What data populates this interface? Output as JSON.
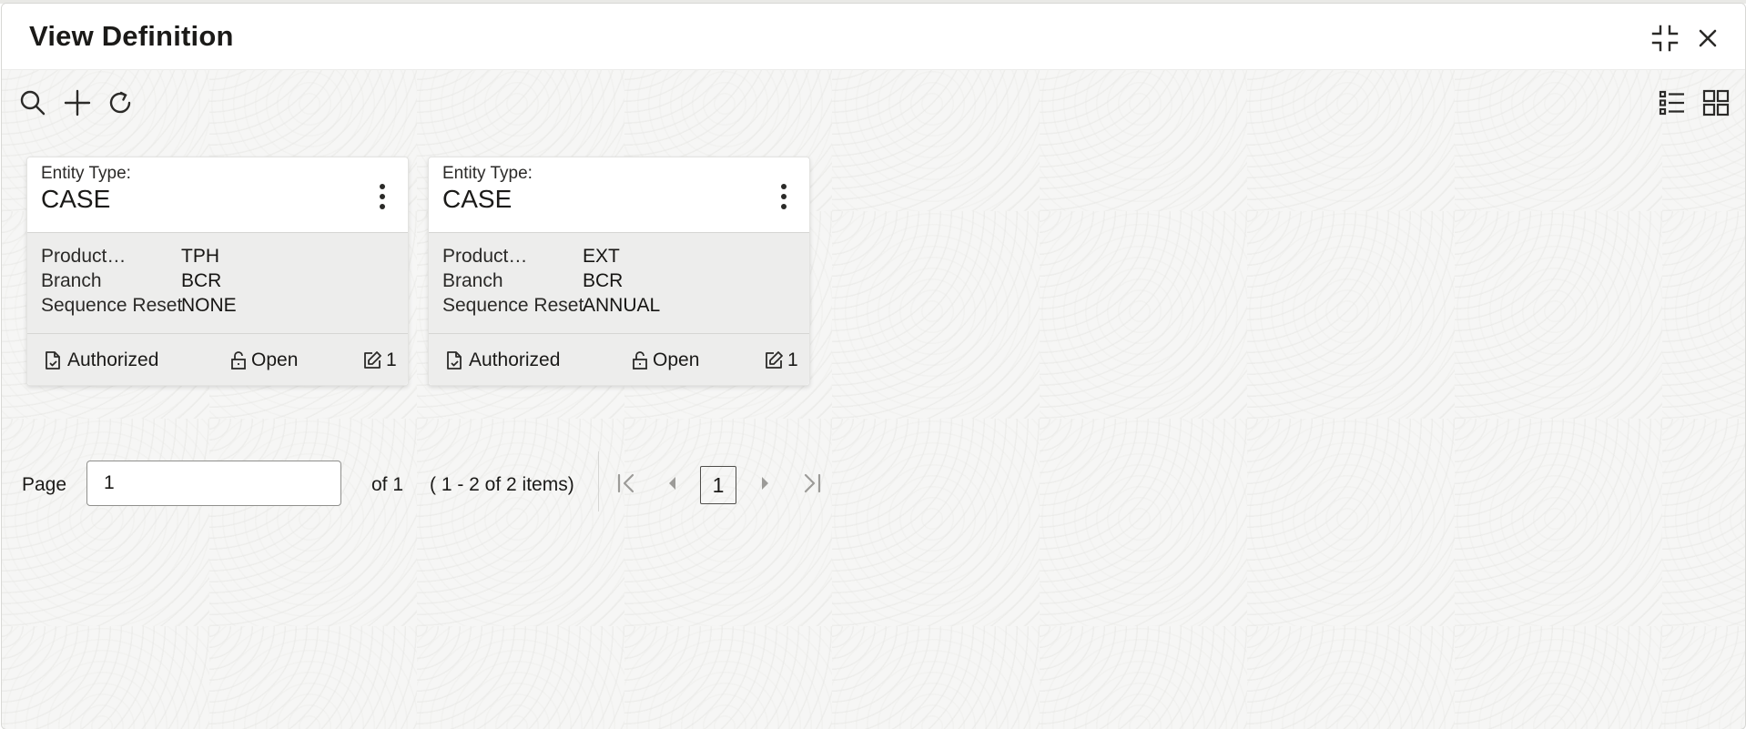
{
  "dialog": {
    "title": "View Definition",
    "restore_icon": "collapse-arrows-icon",
    "close_icon": "close-icon"
  },
  "toolbar": {
    "search_icon": "search-icon",
    "add_icon": "plus-icon",
    "refresh_icon": "refresh-icon",
    "list_view_icon": "list-view-icon",
    "grid_view_icon": "grid-view-icon"
  },
  "cards": [
    {
      "entity_label": "Entity Type:",
      "entity_value": "CASE",
      "fields": [
        {
          "key": "Product…",
          "value": "TPH"
        },
        {
          "key": "Branch",
          "value": "BCR"
        },
        {
          "key": "Sequence Reset",
          "value": "NONE"
        }
      ],
      "status": "Authorized",
      "lock_status": "Open",
      "mod_no": "1"
    },
    {
      "entity_label": "Entity Type:",
      "entity_value": "CASE",
      "fields": [
        {
          "key": "Product…",
          "value": "EXT"
        },
        {
          "key": "Branch",
          "value": "BCR"
        },
        {
          "key": "Sequence Reset",
          "value": "ANNUAL"
        }
      ],
      "status": "Authorized",
      "lock_status": "Open",
      "mod_no": "1"
    }
  ],
  "pager": {
    "page_label": "Page",
    "page_value": "1",
    "of_text": "of 1",
    "items_text": "( 1 - 2 of 2 items)",
    "current_page": "1"
  },
  "colors": {
    "text": "#161513",
    "card_body": "#ededec",
    "disabled_icon": "#9c9b98"
  }
}
